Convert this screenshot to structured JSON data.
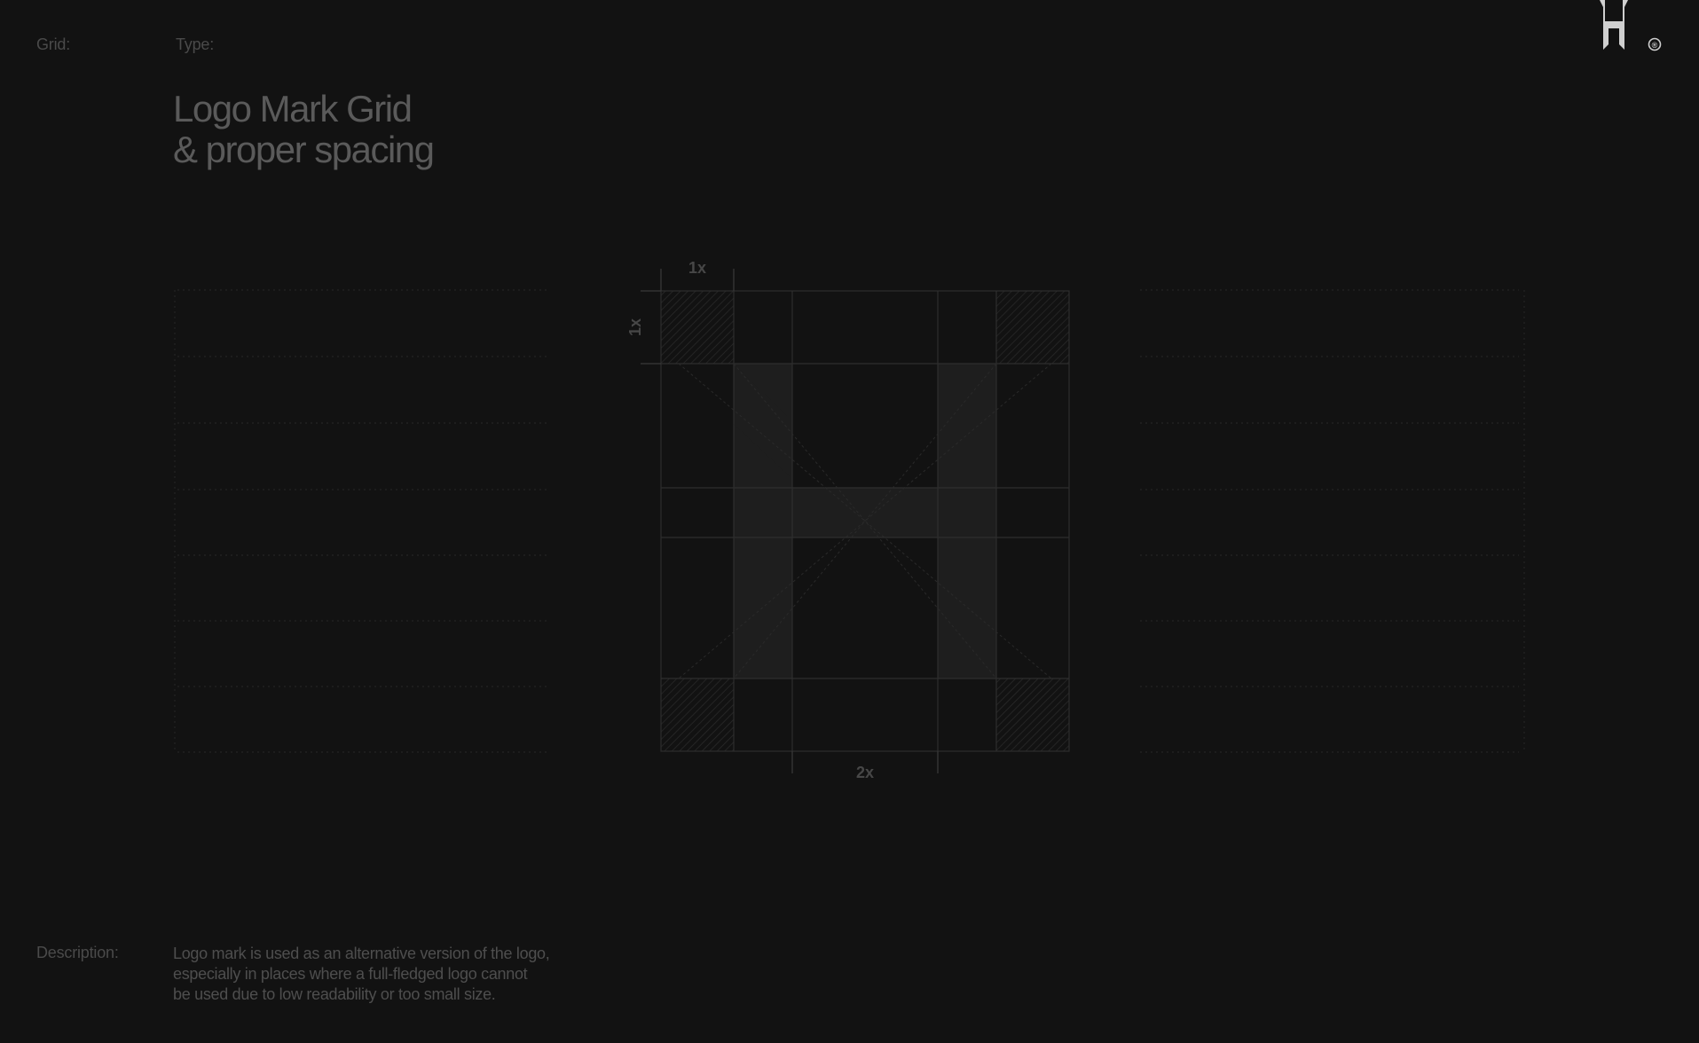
{
  "header": {
    "grid_label": "Grid:",
    "type_label": "Type:",
    "title_lines": [
      "Logo Mark Grid",
      "& proper spacing"
    ]
  },
  "diagram": {
    "top_measure": "1x",
    "side_measure": "1x",
    "bottom_measure": "2x"
  },
  "footer": {
    "description_label": "Description:",
    "description_lines": [
      "Logo mark is used as an alternative version of the logo,",
      "especially in places where a full-fledged logo cannot",
      "be used due to low readability or too small size."
    ]
  },
  "brand": {
    "icon": "h-logo-icon",
    "registered": "®"
  },
  "colors": {
    "background": "#121212",
    "text_dim": "#4a4a4a",
    "grid": "#2e2e2e"
  }
}
